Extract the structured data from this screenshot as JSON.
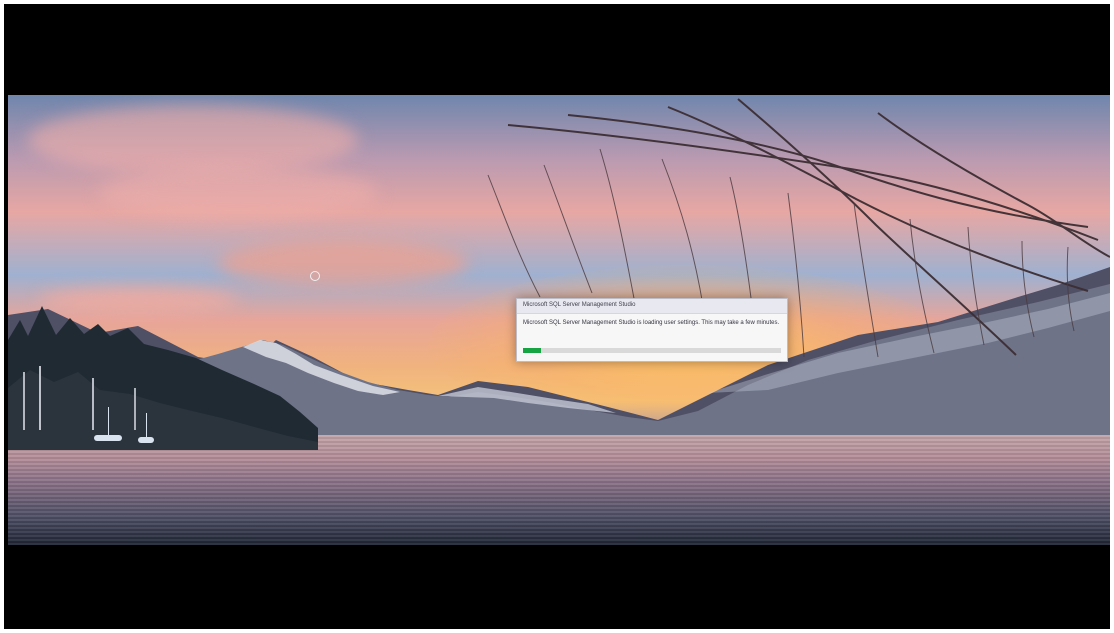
{
  "dialog": {
    "title": "Microsoft SQL Server Management Studio",
    "message": "Microsoft SQL Server Management Studio is loading user settings. This may take a few minutes.",
    "progress_percent": 7,
    "progress_color": "#16a341"
  },
  "desktop": {
    "wallpaper_desc_icons": [
      "lake-landscape-wallpaper",
      "loading-cursor-icon"
    ],
    "colors": {
      "sky_top": "#6f86ad",
      "sunset": "#f4c27a",
      "pink_cloud": "#e7a7a3",
      "water_dark": "#1e2433"
    }
  }
}
